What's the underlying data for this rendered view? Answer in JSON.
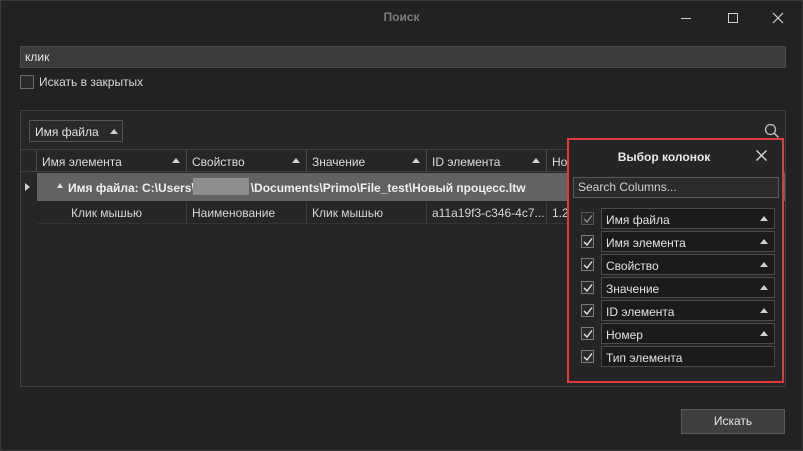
{
  "window": {
    "title": "Поиск"
  },
  "search": {
    "query": "клик"
  },
  "options": {
    "search_closed_label": "Искать в закрытых",
    "search_closed_checked": false
  },
  "results": {
    "group_by_label": "Имя файла",
    "columns": [
      "Имя элемента",
      "Свойство",
      "Значение",
      "ID элемента",
      "Но"
    ],
    "group_row_prefix": "Имя файла: C:\\Users\\",
    "group_row_suffix": "\\Documents\\Primo\\File_test\\Новый процесс.ltw",
    "rows": [
      [
        "Клик мышью",
        "Наименование",
        "Клик мышью",
        "a11a19f3-c346-4c7...",
        "1.2"
      ]
    ]
  },
  "column_chooser": {
    "title": "Выбор колонок",
    "search_placeholder": "Search Columns...",
    "items": [
      {
        "label": "Имя файла",
        "checked": true,
        "disabled": true,
        "sort": true
      },
      {
        "label": "Имя элемента",
        "checked": true,
        "disabled": false,
        "sort": true
      },
      {
        "label": "Свойство",
        "checked": true,
        "disabled": false,
        "sort": true
      },
      {
        "label": "Значение",
        "checked": true,
        "disabled": false,
        "sort": true
      },
      {
        "label": "ID элемента",
        "checked": true,
        "disabled": false,
        "sort": true
      },
      {
        "label": "Номер",
        "checked": true,
        "disabled": false,
        "sort": true
      },
      {
        "label": "Тип элемента",
        "checked": true,
        "disabled": false,
        "sort": false
      }
    ],
    "highlight_color": "#e13a3a"
  },
  "footer": {
    "search_button_label": "Искать"
  }
}
